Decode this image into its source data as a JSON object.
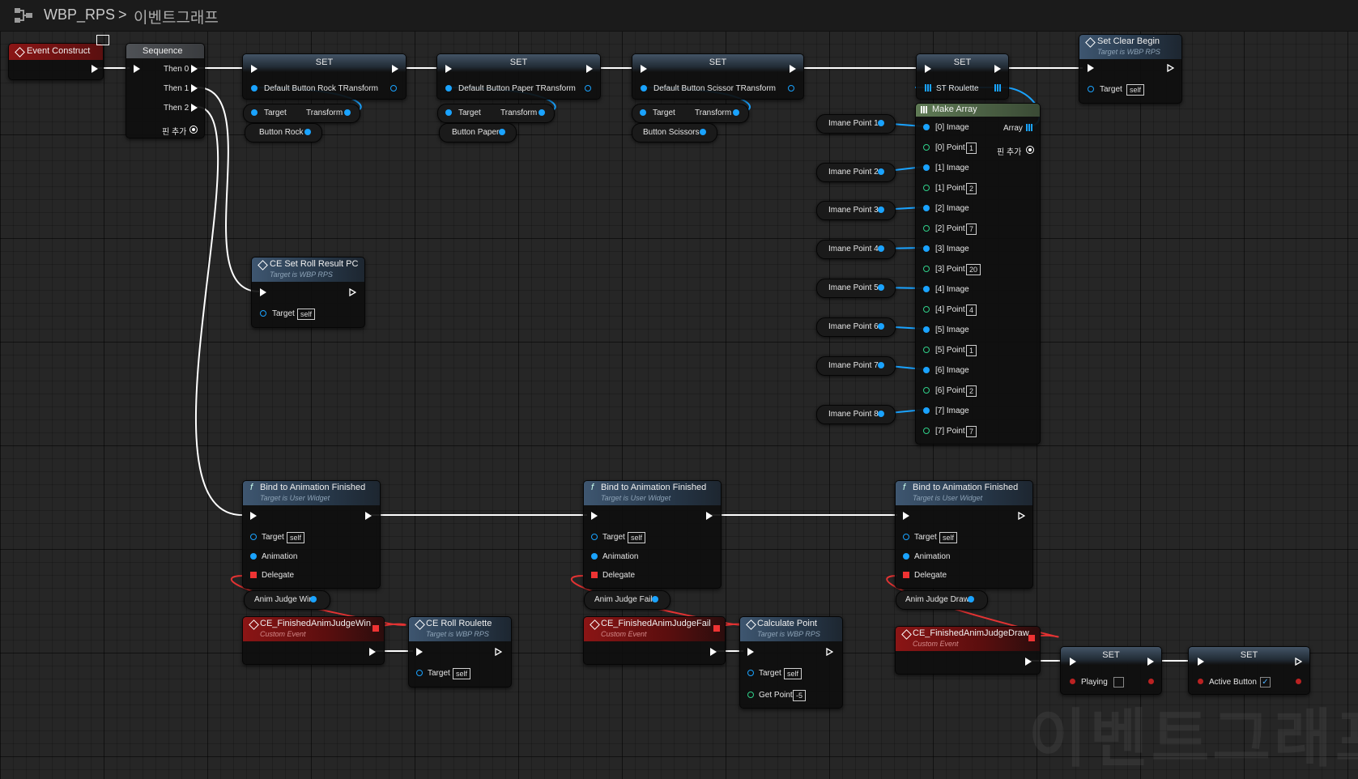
{
  "breadcrumb": {
    "blueprint": "WBP_RPS",
    "separator": ">",
    "graph": "이벤트그래프"
  },
  "watermark": "이벤트그래프",
  "colors": {
    "exec_wire": "#ffffff",
    "object_pin": "#1aa3ff",
    "struct_pin": "#2fd18a",
    "delegate_pin": "#e33333",
    "event_header": "#8b1515",
    "function_header": "#3e5670",
    "array_header": "#5f7a55"
  },
  "nodes": {
    "event_construct": {
      "title": "Event Construct",
      "icon": "monitor-icon"
    },
    "sequence": {
      "title": "Sequence",
      "then0": "Then 0",
      "then1": "Then 1",
      "then2": "Then 2",
      "add_pin": "핀 추가"
    },
    "set_rock": {
      "title": "SET",
      "var": "Default Button Rock TRansform"
    },
    "set_paper": {
      "title": "SET",
      "var": "Default Button Paper TRansform"
    },
    "set_scissor": {
      "title": "SET",
      "var": "Default Button Scissor TRansform"
    },
    "set_st_roulette": {
      "title": "SET",
      "var": "ST Roulette"
    },
    "set_clear_begin": {
      "title": "Set Clear Begin",
      "subtitle": "Target is WBP RPS",
      "target": "Target",
      "target_val": "self"
    },
    "get_transform_rock": {
      "target": "Target",
      "output": "Transform",
      "input": "Button Rock"
    },
    "get_transform_paper": {
      "target": "Target",
      "output": "Transform",
      "input": "Button Paper"
    },
    "get_transform_scissors": {
      "target": "Target",
      "output": "Transform",
      "input": "Button Scissors"
    },
    "make_array": {
      "title": "Make Array",
      "output": "Array",
      "add_pin": "핀 추가",
      "pins": [
        {
          "image": "[0] Image",
          "point": "[0] Point",
          "value": "1"
        },
        {
          "image": "[1] Image",
          "point": "[1] Point",
          "value": "2"
        },
        {
          "image": "[2] Image",
          "point": "[2] Point",
          "value": "7"
        },
        {
          "image": "[3] Image",
          "point": "[3] Point",
          "value": "20"
        },
        {
          "image": "[4] Image",
          "point": "[4] Point",
          "value": "4"
        },
        {
          "image": "[5] Image",
          "point": "[5] Point",
          "value": "1"
        },
        {
          "image": "[6] Image",
          "point": "[6] Point",
          "value": "2"
        },
        {
          "image": "[7] Image",
          "point": "[7] Point",
          "value": "7"
        }
      ]
    },
    "image_points": [
      "Imane Point 1",
      "Imane Point 2",
      "Imane Point 3",
      "Imane Point 4",
      "Imane Point 5",
      "Imane Point 6",
      "Imane Point 7",
      "Imane Point 8"
    ],
    "ce_set_roll_result": {
      "title": "CE Set Roll Result PC",
      "subtitle": "Target is WBP RPS",
      "target": "Target",
      "target_val": "self"
    },
    "bind_win": {
      "title": "Bind to Animation Finished",
      "subtitle": "Target is User Widget",
      "target": "Target",
      "target_val": "self",
      "animation": "Animation",
      "delegate": "Delegate",
      "anim_var": "Anim Judge Win"
    },
    "bind_fail": {
      "title": "Bind to Animation Finished",
      "subtitle": "Target is User Widget",
      "target": "Target",
      "target_val": "self",
      "animation": "Animation",
      "delegate": "Delegate",
      "anim_var": "Anim Judge Fail"
    },
    "bind_draw": {
      "title": "Bind to Animation Finished",
      "subtitle": "Target is User Widget",
      "target": "Target",
      "target_val": "self",
      "animation": "Animation",
      "delegate": "Delegate",
      "anim_var": "Anim Judge Draw"
    },
    "ce_win": {
      "title": "CE_FinishedAnimJudgeWin",
      "subtitle": "Custom Event"
    },
    "ce_fail": {
      "title": "CE_FinishedAnimJudgeFail",
      "subtitle": "Custom Event"
    },
    "ce_draw": {
      "title": "CE_FinishedAnimJudgeDraw",
      "subtitle": "Custom Event"
    },
    "ce_roll_roulette": {
      "title": "CE Roll Roulette",
      "subtitle": "Target is WBP RPS",
      "target": "Target",
      "target_val": "self"
    },
    "calculate_point": {
      "title": "Calculate Point",
      "subtitle": "Target is WBP RPS",
      "target": "Target",
      "target_val": "self",
      "get_point": "Get Point",
      "get_point_val": "-5"
    },
    "set_playing": {
      "title": "SET",
      "var": "Playing",
      "checked": false
    },
    "set_active_button": {
      "title": "SET",
      "var": "Active Button",
      "checked": true,
      "check_mark": "✓"
    }
  }
}
